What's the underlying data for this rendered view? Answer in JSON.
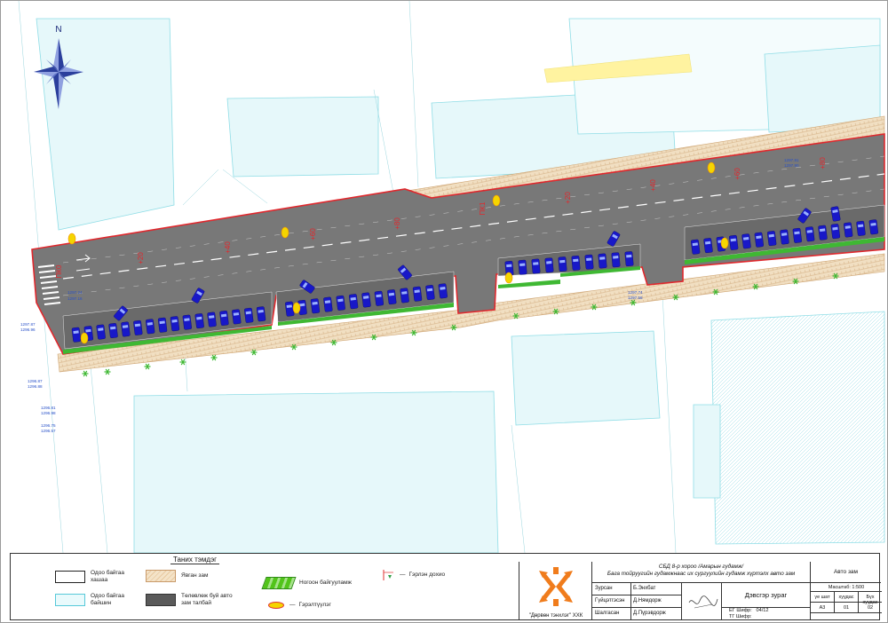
{
  "north": {
    "label": "N"
  },
  "stations": [
    "ПК0",
    "+20",
    "+40",
    "+60",
    "+80",
    "ПК1",
    "+20",
    "+40",
    "+60",
    "+80"
  ],
  "elevations": [
    "1297.24",
    "1297.16",
    "1297.91",
    "1297.90",
    "1297.74",
    "1297.56",
    "1297.87",
    "1296.96",
    "1296.87",
    "1296.88",
    "1296.81",
    "1296.98",
    "1296.75",
    "1296.57"
  ],
  "legend": {
    "title": "Таних тэмдэг",
    "items": {
      "building": "Одоо байгаа\nхашаа",
      "fence": "Одоо байгаа\nбайшин",
      "sidewalk": "Явган зам",
      "parking": "Төлөвлөж буй авто\nзам талбай",
      "green": "Ногоон байгууламж",
      "light": "Гэрлэн дохио",
      "lamp": "Гэрэлтүүлэг"
    }
  },
  "title_block": {
    "company": "\"Дөрвөн тэнхлэг\" ХХК",
    "project_line1": "СБД 8-р хороо /Амарын гудамж/",
    "project_line2": "Бага тойруугийн гудамжнаас их сургуулийн гудамж хүртэлх авто зам",
    "road": "Авто зам",
    "roles": [
      {
        "role": "Зурсан",
        "name": "Б.Энхбат"
      },
      {
        "role": "Гүйцэтгэсэн",
        "name": "Д.Нямдорж"
      },
      {
        "role": "Шалгасан",
        "name": "Д.Пүрэвдорж"
      }
    ],
    "sheet_title": "Дэвсгэр зураг",
    "eg_code": "ЕГ Шифр:",
    "eg_value": "04/12",
    "tg_code": "ТГ Шифр:",
    "scale": "Масштаб: 1:500",
    "headers": [
      "үе шат",
      "хуудас",
      "Бүх хуудас"
    ],
    "values": [
      "А3",
      "01",
      "02"
    ]
  },
  "colors": {
    "road": "#787878",
    "parking": "#6c6c6c",
    "outline": "#e0282d",
    "car": "#1818c8",
    "green": "#3fb833",
    "sidewalk": "#e6cfae",
    "building": "#dff5f7",
    "lamp": "#f5d500"
  }
}
